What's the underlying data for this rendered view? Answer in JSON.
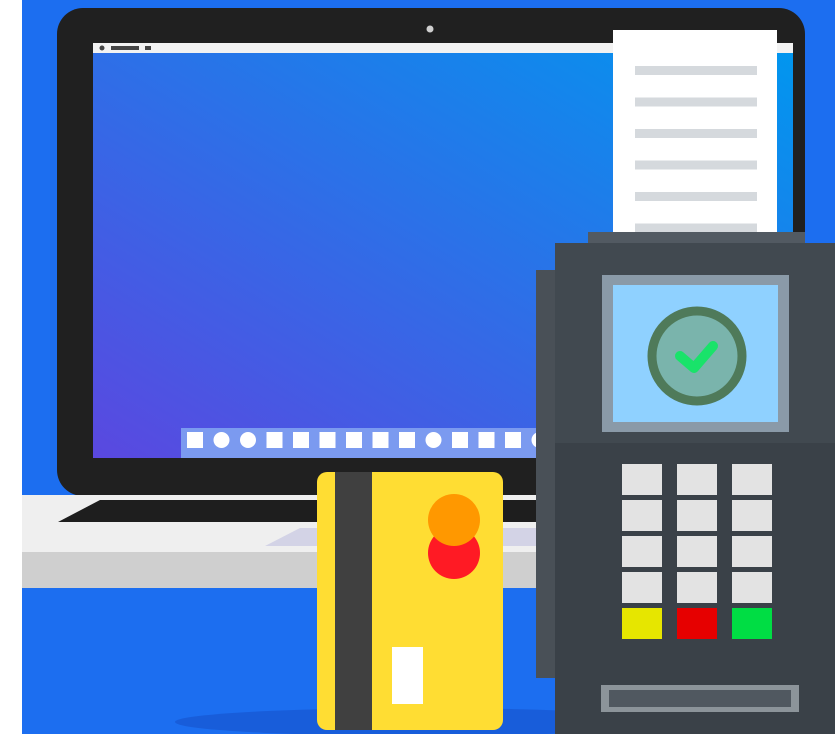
{
  "scene": {
    "title": "",
    "colors": {
      "background": "#1c6ef0",
      "laptop_bezel": "#202020",
      "laptop_base": "#efefef",
      "laptop_base_shadow": "#cfcfcf",
      "screen_gradient_start": "#5a48e0",
      "screen_gradient_end": "#0097ef",
      "dock_bar": "#7b9af0",
      "card": "#ffdd33",
      "card_stripe": "#404040",
      "card_circle_orange": "#ff9800",
      "card_circle_red": "#ff1a24",
      "terminal_body": "#3a4148",
      "terminal_display_bezel": "#8a9aa8",
      "terminal_display": "#8fd1ff",
      "check_ring": "#4f7a5a",
      "check_mark": "#19e36a",
      "receipt": "#ffffff",
      "receipt_line": "#d5d9dd",
      "key_gray": "#e3e3e3",
      "key_yellow": "#e6e600",
      "key_red": "#e60000",
      "key_green": "#00dd44"
    },
    "icons": {
      "success": "check-icon",
      "payment": "credit-card-icon",
      "device": "payment-terminal-icon",
      "computer": "laptop-icon"
    },
    "dock_icons": [
      "square",
      "circle",
      "circle",
      "square",
      "square",
      "square",
      "square",
      "square",
      "square",
      "circle",
      "square",
      "square",
      "square",
      "circle"
    ],
    "keypad_rows": [
      [
        "gray",
        "gray",
        "gray"
      ],
      [
        "gray",
        "gray",
        "gray"
      ],
      [
        "gray",
        "gray",
        "gray"
      ],
      [
        "gray",
        "gray",
        "gray"
      ],
      [
        "yellow",
        "red",
        "green"
      ]
    ],
    "receipt_lines": 6
  }
}
